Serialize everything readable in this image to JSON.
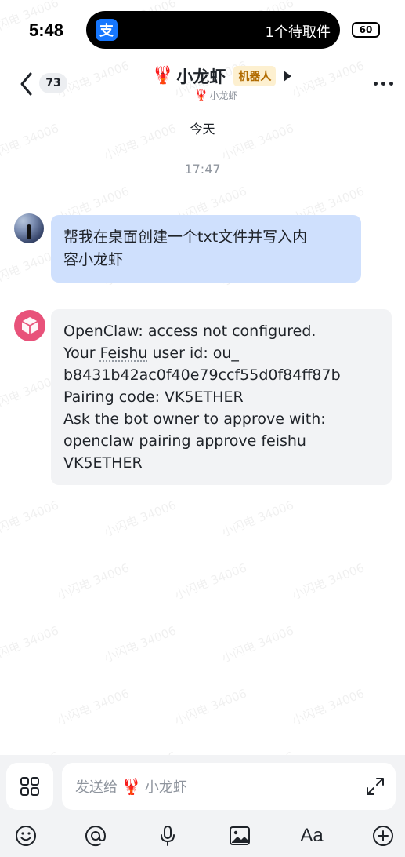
{
  "status_bar": {
    "time": "5:48",
    "island_app_icon": "支",
    "island_text": "1个待取件",
    "battery": "60"
  },
  "header": {
    "back_icon": "chevron-left-icon",
    "unread_count": "73",
    "title_emoji": "🦞",
    "title": "小龙虾",
    "bot_tag": "机器人",
    "subtitle_emoji": "🦞",
    "subtitle": "小龙虾",
    "more_icon": "more-icon"
  },
  "chat": {
    "date_divider": "今天",
    "timestamp": "17:47",
    "messages": [
      {
        "sender": "user",
        "lines": [
          "帮我在桌面创建一个txt文件并写入内",
          "容小龙虾"
        ]
      },
      {
        "sender": "bot",
        "lines": [
          "OpenClaw: access not configured.",
          "Your ",
          "Feishu",
          " user id: ou_",
          "b8431b42ac0f40e79ccf55d0f84ff87b",
          "Pairing code: VK5ETHER",
          "Ask the bot owner to approve with:",
          "openclaw pairing approve feishu",
          "VK5ETHER"
        ]
      }
    ]
  },
  "composer": {
    "placeholder_prefix": "发送给",
    "placeholder_emoji": "🦞",
    "placeholder_name": "小龙虾",
    "toolbar_aa": "Aa"
  },
  "watermark": "小闪电 34006",
  "colors": {
    "user_bubble": "#cfe0fd",
    "bot_bubble": "#f2f3f5",
    "bot_tag_bg": "#fdf0d0",
    "bot_tag_text": "#b06a00",
    "bot_avatar": "#e8527a"
  }
}
